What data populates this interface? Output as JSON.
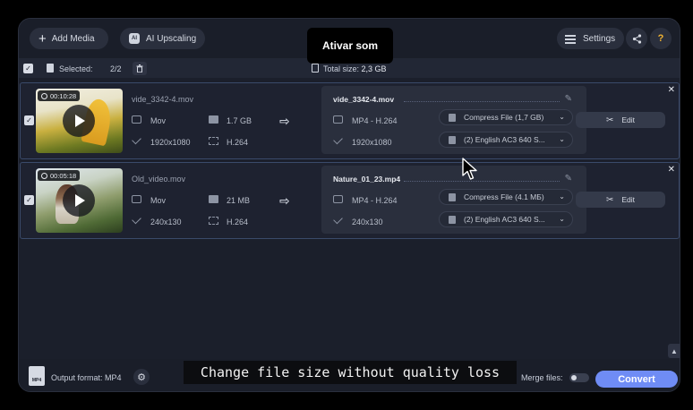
{
  "toolbar": {
    "add_media_label": "Add Media",
    "ai_upscaling_label": "AI Upscaling",
    "ai_badge": "AI",
    "settings_label": "Settings",
    "help_glyph": "?",
    "tooltip_text": "Ativar som"
  },
  "selection_bar": {
    "selected_label": "Selected:",
    "selected_count": "2/2",
    "total_size_label": "Total size:",
    "total_size_value": "2,3 GB"
  },
  "files": [
    {
      "duration": "00:10:28",
      "source": {
        "name": "vide_3342-4.mov",
        "format": "Mov",
        "size": "1.7 GB",
        "resolution": "1920x1080",
        "codec": "H.264"
      },
      "target": {
        "name": "vide_3342-4.mov",
        "format": "MP4 - H.264",
        "resolution": "1920x1080",
        "compress": "Compress File (1,7 GB)",
        "audio": "(2) English AC3 640 S..."
      },
      "edit_label": "Edit"
    },
    {
      "duration": "00:05:18",
      "source": {
        "name": "Old_video.mov",
        "format": "Mov",
        "size": "21 MB",
        "resolution": "240x130",
        "codec": "H.264"
      },
      "target": {
        "name": "Nature_01_23.mp4",
        "format": "MP4 - H.264",
        "resolution": "240x130",
        "compress": "Compress File (4.1 MБ)",
        "audio": "(2) English AC3 640 S..."
      },
      "edit_label": "Edit"
    }
  ],
  "footer": {
    "format_icon_text": "MP4",
    "output_format_label": "Output format: MP4",
    "caption": "Change file size without quality loss",
    "merge_label": "Merge files:",
    "merge_enabled": false,
    "convert_label": "Convert"
  },
  "colors": {
    "background": "#1b1f2b",
    "panel": "#2a2f3d",
    "accent": "#6f8cf5",
    "help": "#f0b232"
  }
}
